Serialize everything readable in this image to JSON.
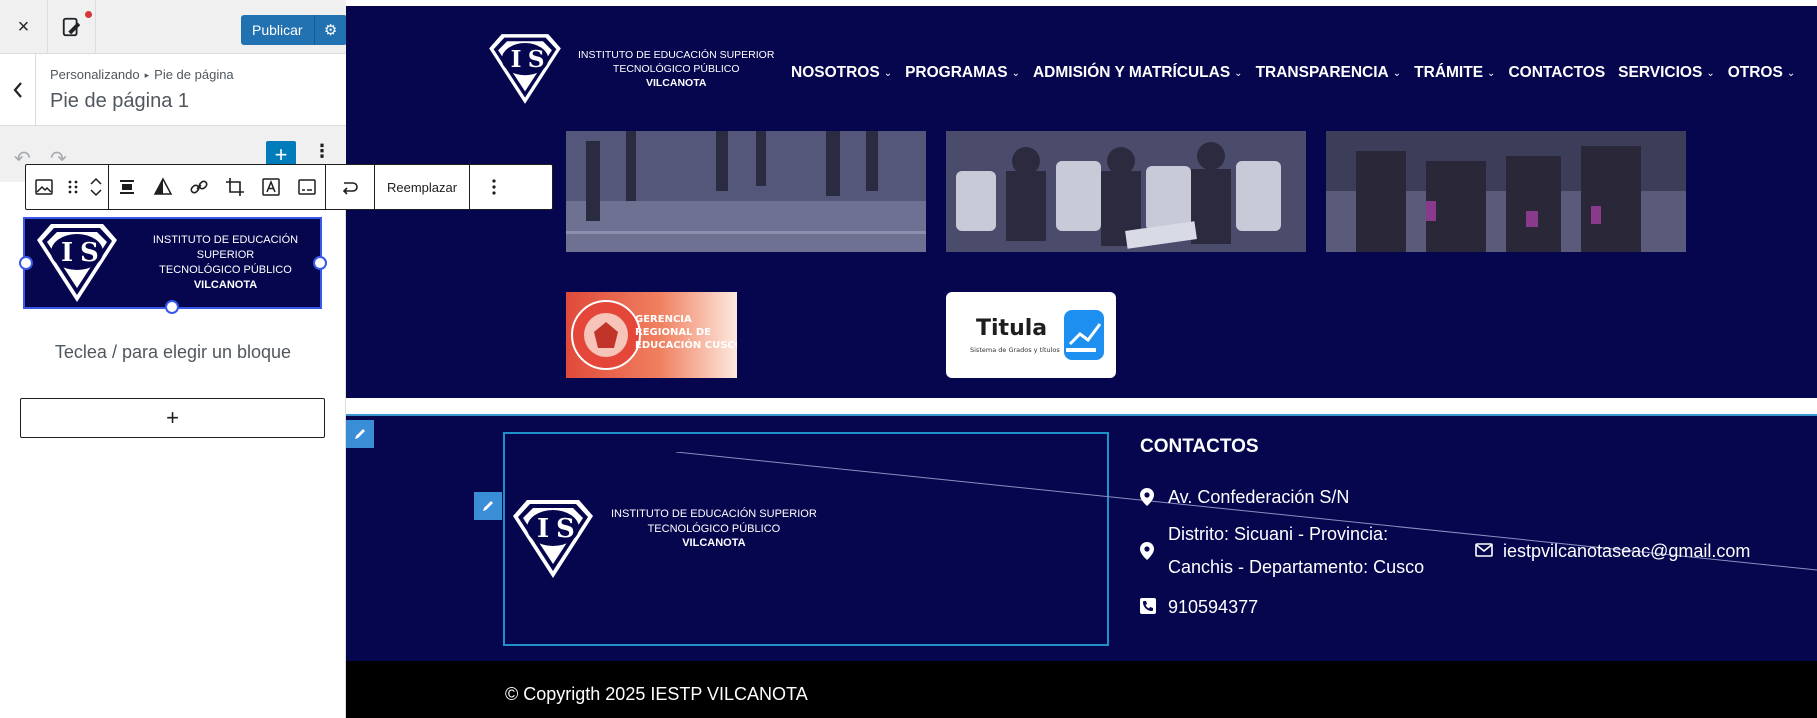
{
  "sidebar": {
    "close_label": "×",
    "publish_label": "Publicar",
    "breadcrumb": {
      "parent": "Personalizando",
      "current": "Pie de página"
    },
    "section_title": "Pie de página 1",
    "block_toolbar": {
      "replace_label": "Reemplazar"
    },
    "block_placeholder": "Teclea / para elegir un bloque",
    "add_block_label": "+"
  },
  "logo": {
    "initials_left": "I",
    "initials_right": "S",
    "line1": "INSTITUTO DE EDUCACIÓN SUPERIOR",
    "line2": "TECNOLÓGICO PÚBLICO",
    "line3": "VILCANOTA"
  },
  "nav": {
    "items": [
      {
        "label": "NOSOTROS",
        "dropdown": true
      },
      {
        "label": "PROGRAMAS",
        "dropdown": true
      },
      {
        "label": "ADMISIÓN Y MATRÍCULAS",
        "dropdown": true
      },
      {
        "label": "TRANSPARENCIA",
        "dropdown": true
      },
      {
        "label": "TRÁMITE",
        "dropdown": true
      },
      {
        "label": "CONTACTOS",
        "dropdown": false
      },
      {
        "label": "SERVICIOS",
        "dropdown": true
      },
      {
        "label": "OTROS",
        "dropdown": true
      }
    ],
    "chevron": "⌄"
  },
  "partners": {
    "gerencia": {
      "line1": "GERENCIA",
      "line2": "REGIONAL DE",
      "line3": "EDUCACIÓN CUSCO"
    },
    "titula": {
      "name": "Titula",
      "tagline": "Sistema de Grados y títulos"
    }
  },
  "footer": {
    "contacts_title": "CONTACTOS",
    "address": "Av. Confederación S/N",
    "district_line1": "Distrito: Sicuani - Provincia:",
    "district_line2": "Canchis - Departamento: Cusco",
    "phone": "910594377",
    "email": "iestpvilcanotaseac@gmail.com",
    "copyright": "© Copyrigth 2025 IESTP VILCANOTA"
  },
  "colors": {
    "navy": "#06064f",
    "wp_blue": "#2271b1",
    "block_blue": "#3858e9",
    "footer_outline": "#1e91c8"
  }
}
